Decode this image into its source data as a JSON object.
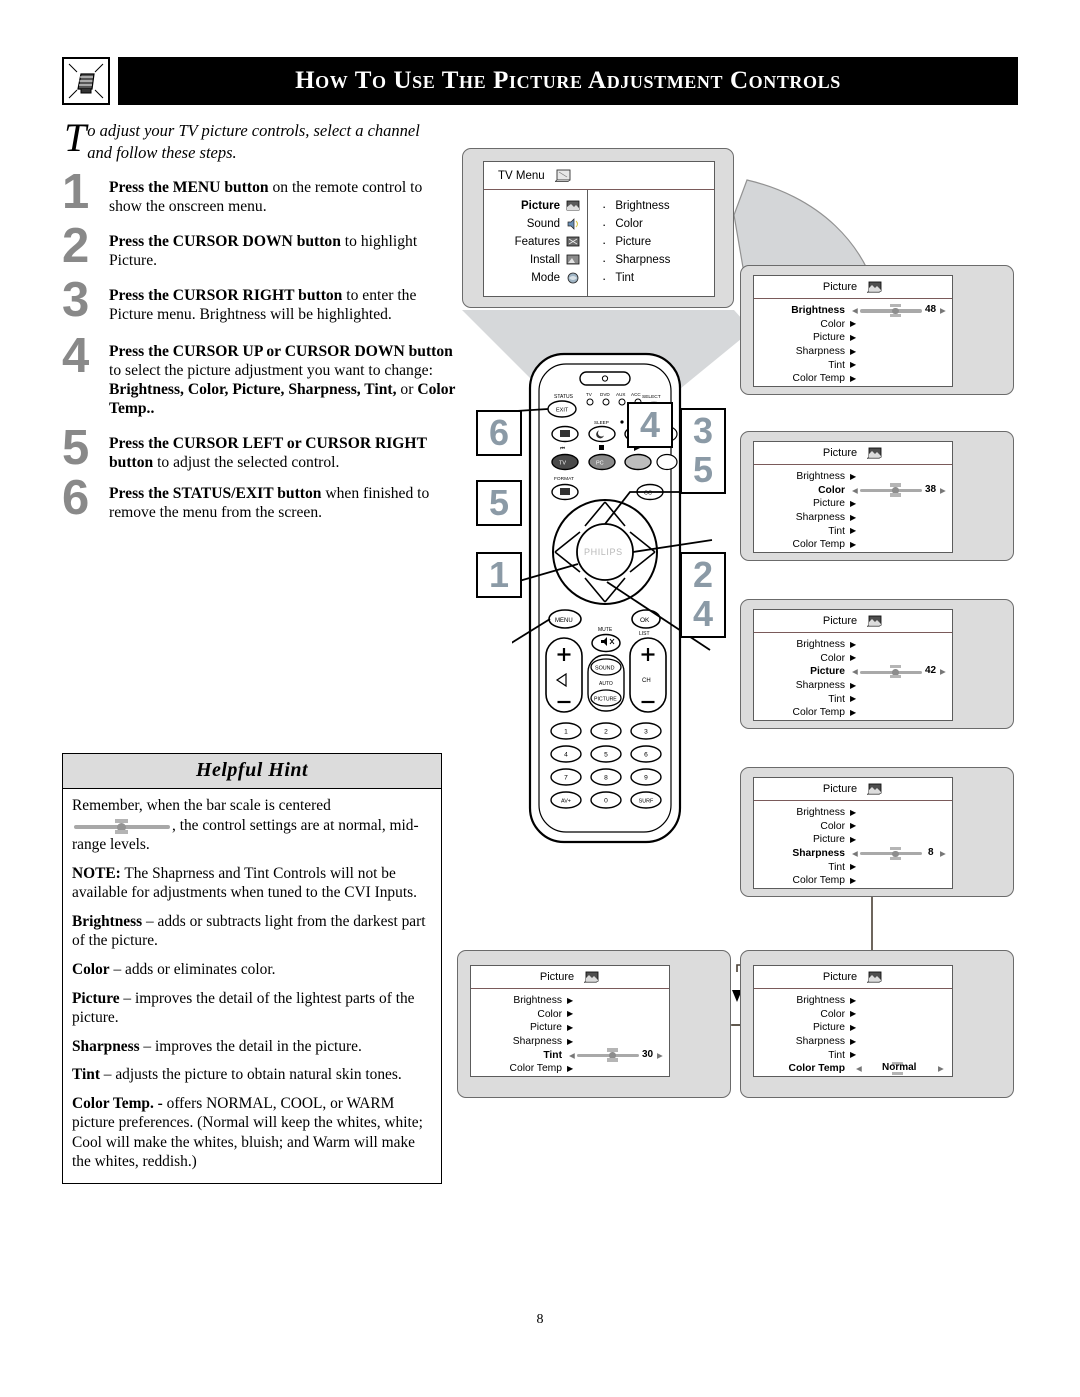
{
  "header": {
    "title": "How to Use the Picture Adjustment Controls",
    "icon": "tv-stand-icon"
  },
  "intro": {
    "dropcap": "T",
    "text": "o adjust your TV picture controls, select a channel and follow these steps."
  },
  "steps": [
    {
      "num": "1",
      "bold_lead": "Press the MENU button",
      "rest": " on the remote control to show the onscreen menu."
    },
    {
      "num": "2",
      "bold_lead": "Press the CURSOR DOWN button",
      "rest": " to highlight Picture."
    },
    {
      "num": "3",
      "bold_lead": "Press the CURSOR RIGHT button",
      "rest": " to enter the Picture menu. Brightness will be highlighted."
    },
    {
      "num": "4",
      "bold_lead": "Press the CURSOR UP or CURSOR DOWN button",
      "rest": " to select the picture adjustment you want to change:  ",
      "bold_tail": "Brightness, Color, Picture, Sharpness, Tint,",
      "rest2": " or ",
      "bold_tail2": "Color Temp.."
    },
    {
      "num": "5",
      "bold_lead": "Press the CURSOR LEFT or CURSOR RIGHT button",
      "rest": " to adjust the selected control."
    },
    {
      "num": "6",
      "bold_lead": "Press the STATUS/EXIT button",
      "rest": " when finished to remove the menu from the screen."
    }
  ],
  "hint": {
    "title": "Helpful Hint",
    "p1_a": "Remember, when the bar scale is centered",
    "p1_b": ", the control settings are at normal, mid-range levels.",
    "p2_bold": "NOTE:",
    "p2": " The Shaprness and Tint Controls will not be available for adjustments when tuned to the CVI  Inputs.",
    "p3_bold": "Brightness",
    "p3": " – adds or subtracts light from the darkest part of the picture.",
    "p4_bold": "Color",
    "p4": " – adds or eliminates color.",
    "p5_bold": "Picture",
    "p5": " – improves the detail of the lightest parts of the picture.",
    "p6_bold": "Sharpness",
    "p6": " – improves the detail in the picture.",
    "p7_bold": "Tint",
    "p7": " – adjusts the picture to obtain natural skin tones.",
    "p8_bold": "Color Temp. -",
    "p8": " offers NORMAL, COOL, or WARM picture preferences. (Normal will keep the whites, white; Cool will make the whites, bluish; and Warm will make the whites, reddish.)"
  },
  "tv_menu": {
    "title": "TV Menu",
    "title_icon": "tv-screen-icon",
    "left_items": [
      {
        "label": "Picture",
        "icon": "picture-icon",
        "selected": true
      },
      {
        "label": "Sound",
        "icon": "sound-icon",
        "selected": false
      },
      {
        "label": "Features",
        "icon": "features-icon",
        "selected": false
      },
      {
        "label": "Install",
        "icon": "install-icon",
        "selected": false
      },
      {
        "label": "Mode",
        "icon": "mode-icon",
        "selected": false
      }
    ],
    "right_items": [
      {
        "bullet": "·",
        "label": "Brightness"
      },
      {
        "bullet": "·",
        "label": "Color"
      },
      {
        "bullet": "·",
        "label": "Picture"
      },
      {
        "bullet": "·",
        "label": "Sharpness"
      },
      {
        "bullet": "·",
        "label": "Tint"
      }
    ]
  },
  "panels": [
    {
      "id": "brightness",
      "title": "Picture",
      "title_icon": "picture-icon",
      "rows": [
        {
          "label": "Brightness",
          "selected": true,
          "type": "slider",
          "value": "48",
          "pct": 55
        },
        {
          "label": "Color",
          "selected": false,
          "type": "arrow"
        },
        {
          "label": "Picture",
          "selected": false,
          "type": "arrow"
        },
        {
          "label": "Sharpness",
          "selected": false,
          "type": "arrow"
        },
        {
          "label": "Tint",
          "selected": false,
          "type": "arrow"
        },
        {
          "label": "Color Temp",
          "selected": false,
          "type": "arrow"
        }
      ]
    },
    {
      "id": "color",
      "title": "Picture",
      "title_icon": "picture-icon",
      "rows": [
        {
          "label": "Brightness",
          "selected": false,
          "type": "arrow"
        },
        {
          "label": "Color",
          "selected": true,
          "type": "slider",
          "value": "38",
          "pct": 55
        },
        {
          "label": "Picture",
          "selected": false,
          "type": "arrow"
        },
        {
          "label": "Sharpness",
          "selected": false,
          "type": "arrow"
        },
        {
          "label": "Tint",
          "selected": false,
          "type": "arrow"
        },
        {
          "label": "Color Temp",
          "selected": false,
          "type": "arrow"
        }
      ]
    },
    {
      "id": "picture",
      "title": "Picture",
      "title_icon": "picture-icon",
      "rows": [
        {
          "label": "Brightness",
          "selected": false,
          "type": "arrow"
        },
        {
          "label": "Color",
          "selected": false,
          "type": "arrow"
        },
        {
          "label": "Picture",
          "selected": true,
          "type": "slider",
          "value": "42",
          "pct": 55
        },
        {
          "label": "Sharpness",
          "selected": false,
          "type": "arrow"
        },
        {
          "label": "Tint",
          "selected": false,
          "type": "arrow"
        },
        {
          "label": "Color Temp",
          "selected": false,
          "type": "arrow"
        }
      ]
    },
    {
      "id": "sharpness",
      "title": "Picture",
      "title_icon": "picture-icon",
      "rows": [
        {
          "label": "Brightness",
          "selected": false,
          "type": "arrow"
        },
        {
          "label": "Color",
          "selected": false,
          "type": "arrow"
        },
        {
          "label": "Picture",
          "selected": false,
          "type": "arrow"
        },
        {
          "label": "Sharpness",
          "selected": true,
          "type": "slider",
          "value": "8",
          "pct": 55
        },
        {
          "label": "Tint",
          "selected": false,
          "type": "arrow"
        },
        {
          "label": "Color Temp",
          "selected": false,
          "type": "arrow"
        }
      ]
    },
    {
      "id": "tint",
      "title": "Picture",
      "title_icon": "picture-icon",
      "rows": [
        {
          "label": "Brightness",
          "selected": false,
          "type": "arrow"
        },
        {
          "label": "Color",
          "selected": false,
          "type": "arrow"
        },
        {
          "label": "Picture",
          "selected": false,
          "type": "arrow"
        },
        {
          "label": "Sharpness",
          "selected": false,
          "type": "arrow"
        },
        {
          "label": "Tint",
          "selected": true,
          "type": "slider",
          "value": "30",
          "pct": 55
        },
        {
          "label": "Color Temp",
          "selected": false,
          "type": "arrow"
        }
      ]
    },
    {
      "id": "colortemp",
      "title": "Picture",
      "title_icon": "picture-icon",
      "rows": [
        {
          "label": "Brightness",
          "selected": false,
          "type": "arrow"
        },
        {
          "label": "Color",
          "selected": false,
          "type": "arrow"
        },
        {
          "label": "Picture",
          "selected": false,
          "type": "arrow",
          "cursor": true
        },
        {
          "label": "Sharpness",
          "selected": false,
          "type": "arrow"
        },
        {
          "label": "Tint",
          "selected": false,
          "type": "arrow"
        },
        {
          "label": "Color Temp",
          "selected": true,
          "type": "choice",
          "value": "Normal"
        }
      ]
    }
  ],
  "remote": {
    "brand": "PHILIPS",
    "top_labels": [
      "STATUS",
      "SELECT",
      "FORMAT",
      "SLEEP"
    ],
    "source_labels": [
      "TV",
      "DVD",
      "AUX",
      "ACC"
    ],
    "buttons": {
      "exit": "EXIT",
      "tv": "TV",
      "pc": "PC",
      "cc": "CC",
      "menu": "MENU",
      "ok": "OK",
      "list": "LIST",
      "mute": "MUTE",
      "sound": "SOUND",
      "auto": "AUTO",
      "picture": "PICTURE",
      "ch": "CH",
      "av": "AV+",
      "surf": "SURF"
    },
    "keypad": [
      "1",
      "2",
      "3",
      "4",
      "5",
      "6",
      "7",
      "8",
      "9",
      "AV+",
      "0",
      "SURF"
    ]
  },
  "callouts": [
    {
      "id": "co6",
      "values": [
        "6"
      ]
    },
    {
      "id": "co4",
      "values": [
        "4"
      ]
    },
    {
      "id": "co35",
      "values": [
        "3",
        "5"
      ]
    },
    {
      "id": "co5",
      "values": [
        "5"
      ]
    },
    {
      "id": "co1",
      "values": [
        "1"
      ]
    },
    {
      "id": "co24",
      "values": [
        "2",
        "4"
      ]
    }
  ],
  "page_number": "8",
  "colors": {
    "header_bg": "#000000",
    "step_number": "#898989",
    "callout_number": "#8b9aa6",
    "panel_bg": "#dcdcdc",
    "slider_track": "#a9a9a9",
    "hint_header_bg": "#dcdcdc"
  }
}
